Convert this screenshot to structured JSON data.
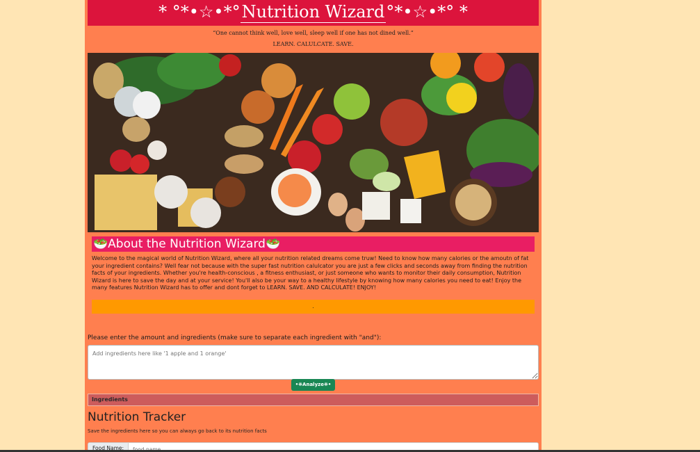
{
  "header": {
    "title": "Nutrition Wizard",
    "decor_left": "* °*•☆•*°",
    "decor_right": "°*•☆•*° *",
    "quote": "“One cannot think well, love well, sleep well if one has not dined well.”",
    "slogan": "LEARN. CALULCATE. SAVE."
  },
  "hero": {
    "icon": "vegetables-photo"
  },
  "about": {
    "emoji": "🥗",
    "title": "About the Nutrition Wizard",
    "body": "Welcome to the magical world of Nutrition Wizard, where all your nutrition related dreams come truw! Need to know how many calories or the amoutn of fat your ingredient contains? Well fear not because with the super fast nutrition calulcator you are just a few clicks and seconds away from finding the nutrition facts of your ingredients. Whether you're health-conscious , a fitness enthusiast, or just someone who wants to monitor their daily consumption, Nutrition Wizard is here to save the day and at your service! You'll also be  your way to a healthy lifestyle by knowing how many calories you need to eat! Enjoy the many features Nutrition Wizard has to offer and dont forget to LEARN. SAVE. AND CALCULATE! ENJOY!",
    "bar_text": "."
  },
  "analyzer": {
    "prompt": "Please enter the amount and ingredients (make sure to separate each ingredient with \"and\"):",
    "placeholder": "Add ingredients here like '1 apple and 1 orange'",
    "button_label": "•❋Analyze❋•",
    "results_header": "Ingredients"
  },
  "tracker": {
    "title": "Nutrition Tracker",
    "subtitle": "Save the ingredients here so you can always go back to its nutrition facts",
    "food_label": "Food Name:",
    "food_placeholder": "food name"
  },
  "colors": {
    "background": "#ffe5b4",
    "page": "#ff7f4f",
    "banner": "#dc143c",
    "about_title": "#e91e63",
    "accent_bar": "#ff9900",
    "analyze_button": "#198754",
    "results_header": "#cd5c5c"
  }
}
